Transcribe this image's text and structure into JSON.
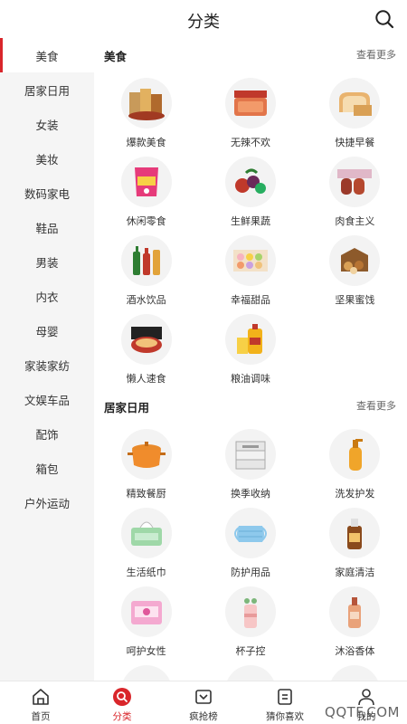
{
  "header": {
    "title": "分类"
  },
  "sidebar": {
    "items": [
      {
        "label": "美食"
      },
      {
        "label": "居家日用"
      },
      {
        "label": "女装"
      },
      {
        "label": "美妆"
      },
      {
        "label": "数码家电"
      },
      {
        "label": "鞋品"
      },
      {
        "label": "男装"
      },
      {
        "label": "内衣"
      },
      {
        "label": "母婴"
      },
      {
        "label": "家装家纺"
      },
      {
        "label": "文娱车品"
      },
      {
        "label": "配饰"
      },
      {
        "label": "箱包"
      },
      {
        "label": "户外运动"
      }
    ],
    "active_index": 0
  },
  "sections": [
    {
      "title": "美食",
      "more": "查看更多",
      "items": [
        {
          "label": "爆款美食",
          "icon": "food-bundle-icon"
        },
        {
          "label": "无辣不欢",
          "icon": "spicy-meat-icon"
        },
        {
          "label": "快捷早餐",
          "icon": "bread-icon"
        },
        {
          "label": "休闲零食",
          "icon": "snack-bag-icon"
        },
        {
          "label": "生鲜果蔬",
          "icon": "fruit-icon"
        },
        {
          "label": "肉食主义",
          "icon": "sausage-icon"
        },
        {
          "label": "酒水饮品",
          "icon": "drinks-icon"
        },
        {
          "label": "幸福甜品",
          "icon": "macaron-icon"
        },
        {
          "label": "坚果蜜饯",
          "icon": "nuts-icon"
        },
        {
          "label": "懒人速食",
          "icon": "instant-noodle-icon"
        },
        {
          "label": "粮油调味",
          "icon": "oil-bottle-icon"
        }
      ]
    },
    {
      "title": "居家日用",
      "more": "查看更多",
      "items": [
        {
          "label": "精致餐厨",
          "icon": "casserole-pot-icon"
        },
        {
          "label": "换季收纳",
          "icon": "storage-drawer-icon"
        },
        {
          "label": "洗发护发",
          "icon": "shampoo-bottle-icon"
        },
        {
          "label": "生活纸巾",
          "icon": "tissue-icon"
        },
        {
          "label": "防护用品",
          "icon": "face-mask-icon"
        },
        {
          "label": "家庭清洁",
          "icon": "disinfectant-bottle-icon"
        },
        {
          "label": "呵护女性",
          "icon": "sanitary-pad-icon"
        },
        {
          "label": "杯子控",
          "icon": "cup-icon"
        },
        {
          "label": "沐浴香体",
          "icon": "body-wash-icon"
        }
      ]
    }
  ],
  "tabbar": {
    "items": [
      {
        "label": "首页",
        "icon": "home-icon"
      },
      {
        "label": "分类",
        "icon": "category-icon"
      },
      {
        "label": "疯抢榜",
        "icon": "ranking-icon"
      },
      {
        "label": "猜你喜欢",
        "icon": "guess-like-icon"
      },
      {
        "label": "我的",
        "icon": "profile-icon"
      }
    ],
    "active_index": 1
  },
  "watermark": "QQTF.COM",
  "colors": {
    "accent": "#d9262b",
    "sidebar_bg": "#f5f5f5"
  }
}
